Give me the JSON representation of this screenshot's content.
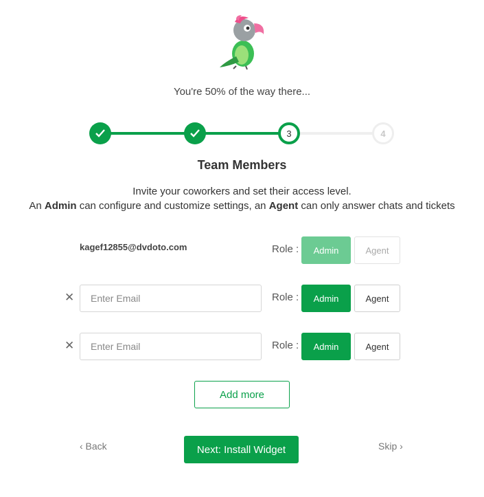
{
  "header": {
    "progress_text": "You're 50% of the way there..."
  },
  "progress": {
    "percent": 50,
    "current_step": 3,
    "total_steps": 4
  },
  "stepper": {
    "steps": [
      {
        "label": "",
        "state": "done"
      },
      {
        "label": "",
        "state": "done"
      },
      {
        "label": "3",
        "state": "current"
      },
      {
        "label": "4",
        "state": "todo"
      }
    ]
  },
  "section": {
    "title": "Team Members",
    "line1": "Invite your coworkers and set their access level.",
    "line2_prefix": "An ",
    "line2_admin": "Admin",
    "line2_mid": " can configure and customize settings, an ",
    "line2_agent": "Agent",
    "line2_suffix": " can only answer chats and tickets"
  },
  "members": [
    {
      "email": "kagef12855@dvdoto.com",
      "role_label": "Role :",
      "admin_label": "Admin",
      "agent_label": "Agent",
      "selected": "Admin",
      "locked": true
    },
    {
      "placeholder": "Enter Email",
      "value": "",
      "role_label": "Role :",
      "admin_label": "Admin",
      "agent_label": "Agent",
      "selected": "Admin",
      "remove_icon": "close-icon"
    },
    {
      "placeholder": "Enter Email",
      "value": "",
      "role_label": "Role :",
      "admin_label": "Admin",
      "agent_label": "Agent",
      "selected": "Admin",
      "remove_icon": "close-icon"
    }
  ],
  "actions": {
    "add_more": "Add more",
    "back": "‹ Back",
    "next": "Next: Install Widget",
    "skip": "Skip ›"
  },
  "colors": {
    "accent": "#0aa04a",
    "accent_light": "#6ccb93"
  }
}
